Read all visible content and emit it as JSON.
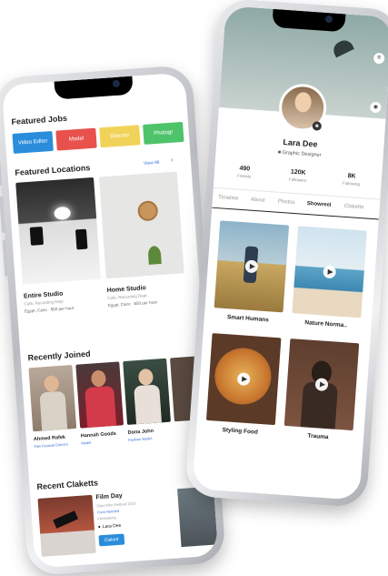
{
  "left_phone": {
    "featured_jobs": {
      "title": "Featured Jobs",
      "chips": [
        {
          "label": "Video Editor",
          "color": "#2a8ddb"
        },
        {
          "label": "Model",
          "color": "#e8514c"
        },
        {
          "label": "Director",
          "color": "#f2d35a"
        },
        {
          "label": "Photogr",
          "color": "#4fc36a"
        }
      ]
    },
    "featured_locations": {
      "title": "Featured Locations",
      "view_all": "View All",
      "items": [
        {
          "name": "Entire Studio",
          "sub": "Cafe, Recording Dept",
          "meta": "Egypt, Cairo · $50 per hour"
        },
        {
          "name": "Home Studio",
          "sub": "Cafe, Recording Dept",
          "meta": "Egypt, Cairo · $50 per hour"
        }
      ]
    },
    "recently_joined": {
      "title": "Recently Joined",
      "people": [
        {
          "name": "Ahmed Rafek",
          "role": "Film Festival Director"
        },
        {
          "name": "Hannah Goods",
          "role": "Model"
        },
        {
          "name": "Dona John",
          "role": "Fashion Model"
        }
      ]
    },
    "recent_claketts": {
      "title": "Recent Claketts",
      "item": {
        "title": "Film Day",
        "sub1": "Short Film Festival 2023",
        "sub2": "Crew Needed",
        "sub3": "Filmmaking",
        "author": "Lara Dee",
        "button": "Clakett"
      }
    }
  },
  "right_phone": {
    "profile": {
      "name": "Lara Dee",
      "role": "Graphic Designer"
    },
    "stats": [
      {
        "value": "490",
        "label": "Friends"
      },
      {
        "value": "120K",
        "label": "Followers"
      },
      {
        "value": "8K",
        "label": "Following"
      }
    ],
    "tabs": [
      "Timeline",
      "About",
      "Photos",
      "Showreel",
      "Claketts"
    ],
    "active_tab": "Showreel",
    "tiles": [
      {
        "title": "Smart Humans"
      },
      {
        "title": "Nature Norma.."
      },
      {
        "title": "Styling Food"
      },
      {
        "title": "Trauma"
      }
    ]
  }
}
